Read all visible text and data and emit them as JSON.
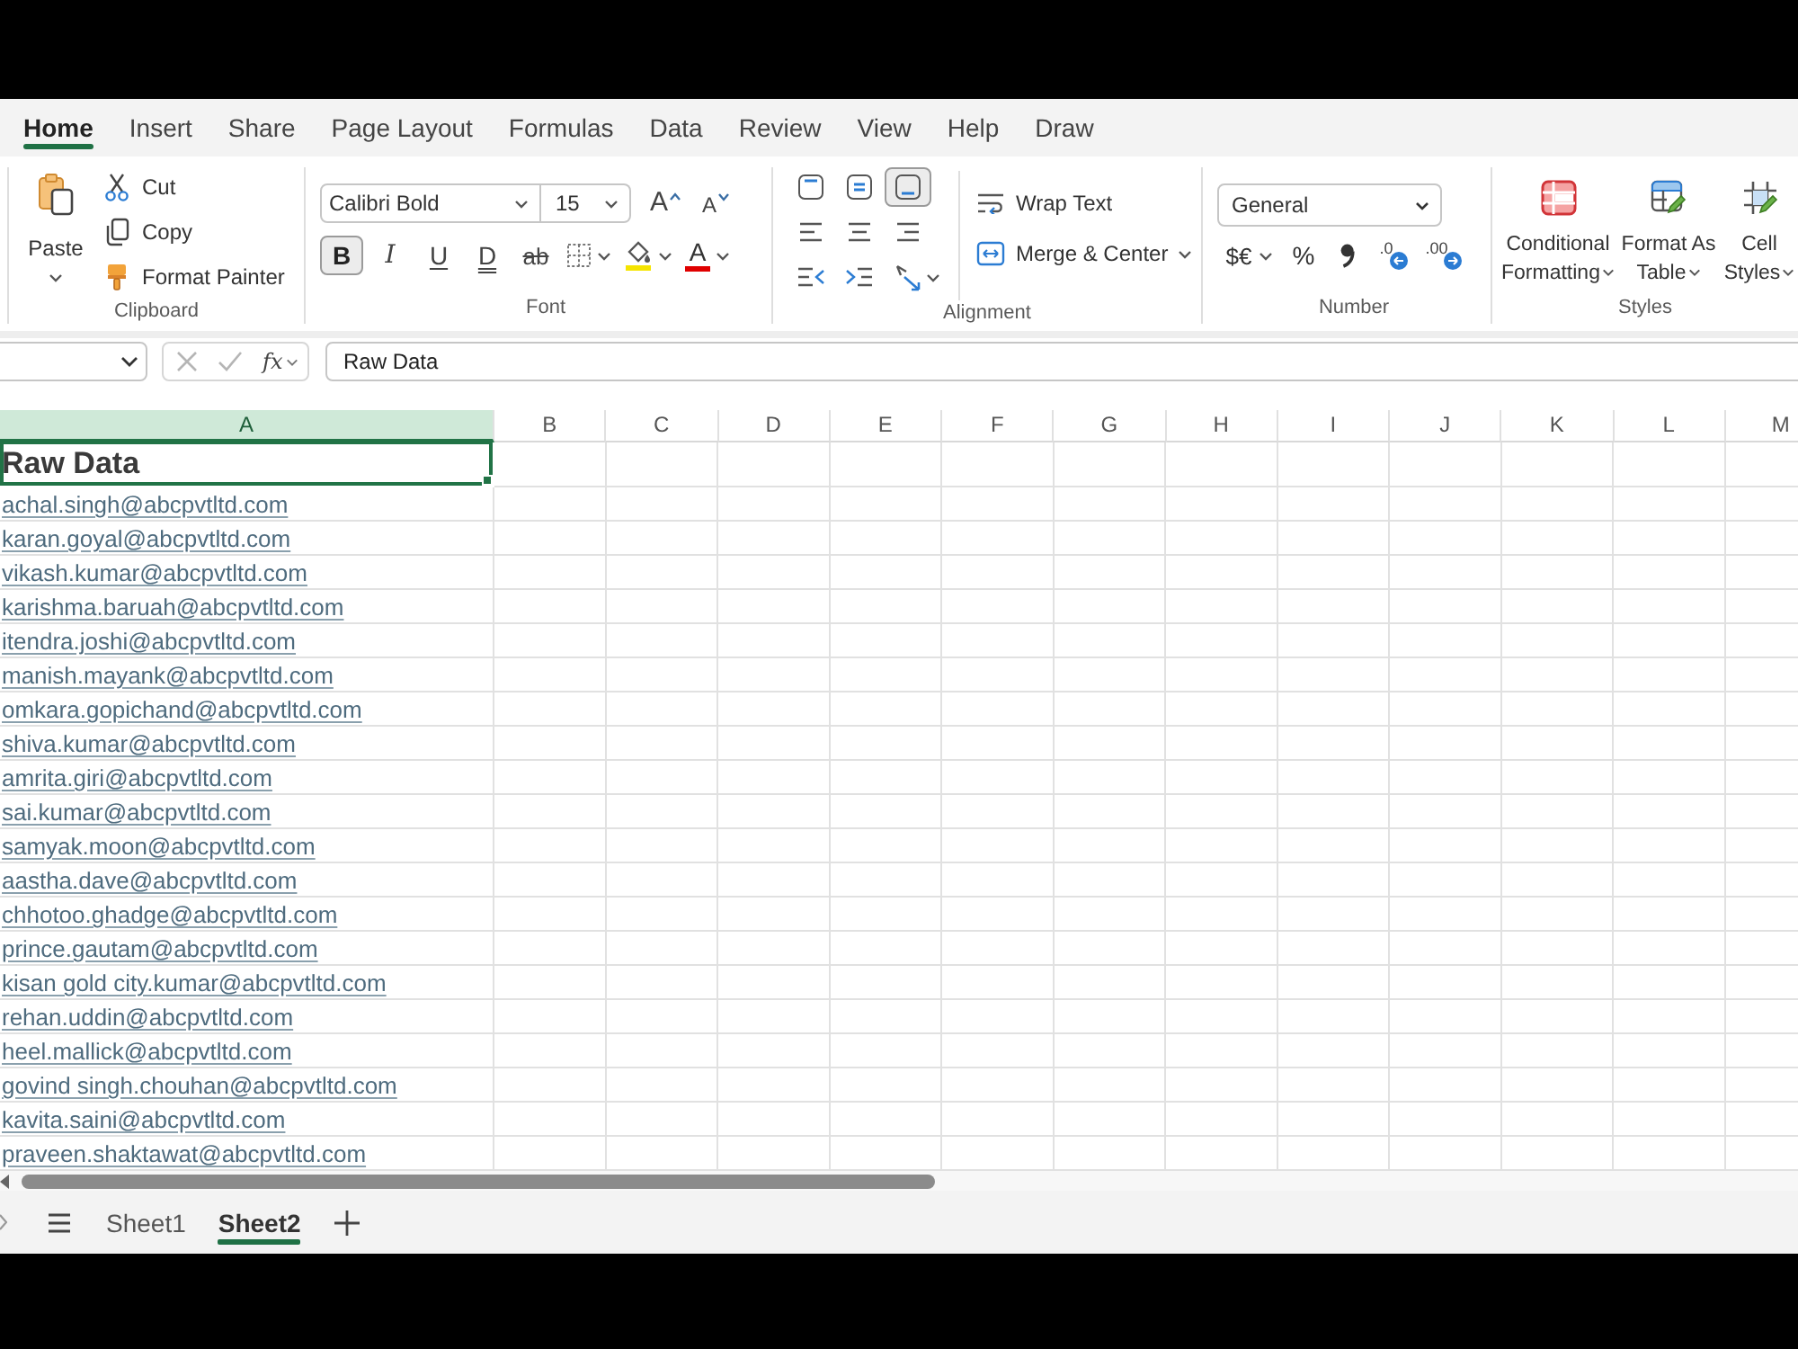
{
  "ribbon_tabs": [
    {
      "label": "Home",
      "selected": true
    },
    {
      "label": "Insert",
      "selected": false
    },
    {
      "label": "Share",
      "selected": false
    },
    {
      "label": "Page Layout",
      "selected": false
    },
    {
      "label": "Formulas",
      "selected": false
    },
    {
      "label": "Data",
      "selected": false
    },
    {
      "label": "Review",
      "selected": false
    },
    {
      "label": "View",
      "selected": false
    },
    {
      "label": "Help",
      "selected": false
    },
    {
      "label": "Draw",
      "selected": false
    }
  ],
  "clipboard": {
    "paste": "Paste",
    "actions": [
      "Cut",
      "Copy",
      "Format Painter"
    ],
    "label": "Clipboard"
  },
  "font": {
    "name": "Calibri Bold",
    "size": "15",
    "grow": "A",
    "shrink": "A",
    "styles": [
      {
        "label": "B",
        "selected": true
      },
      {
        "label": "I",
        "selected": false
      },
      {
        "label": "U",
        "selected": false
      },
      {
        "label": "D",
        "selected": false
      },
      {
        "label": "ab",
        "selected": false
      }
    ],
    "color_letter": "A",
    "label": "Font"
  },
  "alignment": {
    "vertical": [
      {
        "selected": false
      },
      {
        "selected": false
      },
      {
        "selected": true
      }
    ],
    "wrap_text": "Wrap Text",
    "merge": "Merge & Center",
    "label": "Alignment"
  },
  "number": {
    "format": "General",
    "currency": "$€",
    "percent": "%",
    "decimals": [
      ".0",
      ".00"
    ],
    "label": "Number"
  },
  "styles": {
    "buttons": [
      "Conditional Formatting",
      "Format As Table",
      "Cell Styles"
    ],
    "label": "Styles"
  },
  "formula_bar": {
    "controls_disabled": true,
    "function": "fx",
    "value": "Raw Data"
  },
  "columns": [
    {
      "label": "A",
      "selected": true
    },
    {
      "label": "B",
      "selected": false
    },
    {
      "label": "C",
      "selected": false
    },
    {
      "label": "D",
      "selected": false
    },
    {
      "label": "E",
      "selected": false
    },
    {
      "label": "F",
      "selected": false
    },
    {
      "label": "G",
      "selected": false
    },
    {
      "label": "H",
      "selected": false
    },
    {
      "label": "I",
      "selected": false
    },
    {
      "label": "J",
      "selected": false
    },
    {
      "label": "K",
      "selected": false
    },
    {
      "label": "L",
      "selected": false
    },
    {
      "label": "M",
      "selected": false
    }
  ],
  "cells": [
    {
      "kind": "heading",
      "value": "Raw Data",
      "selected": true
    },
    {
      "kind": "link",
      "value": "achal.singh@abcpvtltd.com",
      "selected": false
    },
    {
      "kind": "link",
      "value": "karan.goyal@abcpvtltd.com",
      "selected": false
    },
    {
      "kind": "link",
      "value": "vikash.kumar@abcpvtltd.com",
      "selected": false
    },
    {
      "kind": "link",
      "value": "karishma.baruah@abcpvtltd.com",
      "selected": false
    },
    {
      "kind": "link",
      "value": "itendra.joshi@abcpvtltd.com",
      "selected": false
    },
    {
      "kind": "link",
      "value": "manish.mayank@abcpvtltd.com",
      "selected": false
    },
    {
      "kind": "link",
      "value": "omkara.gopichand@abcpvtltd.com",
      "selected": false
    },
    {
      "kind": "link",
      "value": "shiva.kumar@abcpvtltd.com",
      "selected": false
    },
    {
      "kind": "link",
      "value": "amrita.giri@abcpvtltd.com",
      "selected": false
    },
    {
      "kind": "link",
      "value": "sai.kumar@abcpvtltd.com",
      "selected": false
    },
    {
      "kind": "link",
      "value": "samyak.moon@abcpvtltd.com",
      "selected": false
    },
    {
      "kind": "link",
      "value": "aastha.dave@abcpvtltd.com",
      "selected": false
    },
    {
      "kind": "link",
      "value": "chhotoo.ghadge@abcpvtltd.com",
      "selected": false
    },
    {
      "kind": "link",
      "value": "prince.gautam@abcpvtltd.com",
      "selected": false
    },
    {
      "kind": "link",
      "value": "kisan gold city.kumar@abcpvtltd.com",
      "selected": false
    },
    {
      "kind": "link",
      "value": "rehan.uddin@abcpvtltd.com",
      "selected": false
    },
    {
      "kind": "link",
      "value": "heel.mallick@abcpvtltd.com",
      "selected": false
    },
    {
      "kind": "link",
      "value": "govind singh.chouhan@abcpvtltd.com",
      "selected": false
    },
    {
      "kind": "link",
      "value": "kavita.saini@abcpvtltd.com",
      "selected": false
    },
    {
      "kind": "link",
      "value": "praveen.shaktawat@abcpvtltd.com",
      "selected": false
    }
  ],
  "sheet_tabs": [
    {
      "label": "Sheet1",
      "selected": false
    },
    {
      "label": "Sheet2",
      "selected": true
    }
  ]
}
